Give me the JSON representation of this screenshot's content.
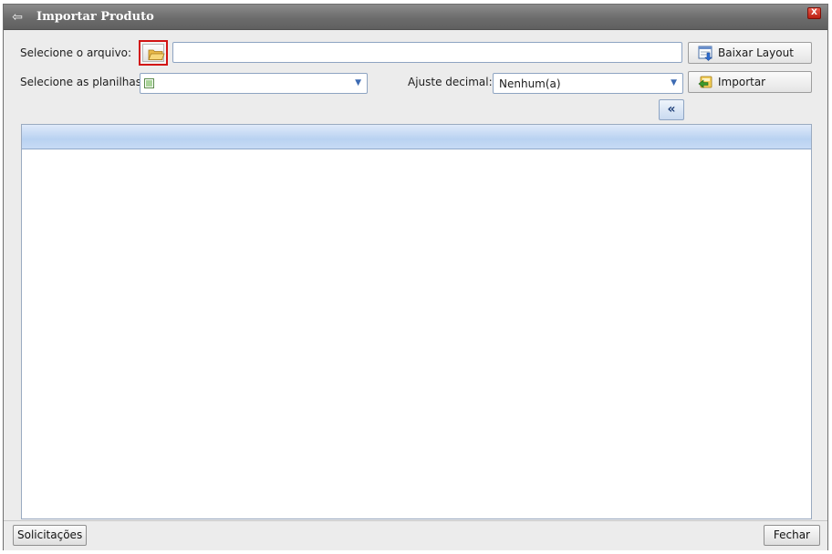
{
  "window": {
    "title": "Importar Produto",
    "close_label": "X"
  },
  "form": {
    "file_label": "Selecione o arquivo:",
    "file_value": "",
    "sheets_label": "Selecione as planilhas:",
    "sheets_value": "",
    "decimal_label": "Ajuste decimal:",
    "decimal_value": "Nenhum(a)"
  },
  "buttons": {
    "download_layout": "Baixar Layout",
    "import": "Importar",
    "collapse": "«"
  },
  "footer": {
    "requests_button": "Solicitações",
    "close_button": "Fechar"
  },
  "icons": {
    "back": "back-arrow-icon",
    "folder": "folder-icon",
    "download": "download-layout-icon",
    "import": "import-icon",
    "sheet": "spreadsheet-icon"
  },
  "colors": {
    "highlight_border": "#d21414",
    "grid_header": "#b9d2f1",
    "titlebar": "#6c6c6c"
  }
}
